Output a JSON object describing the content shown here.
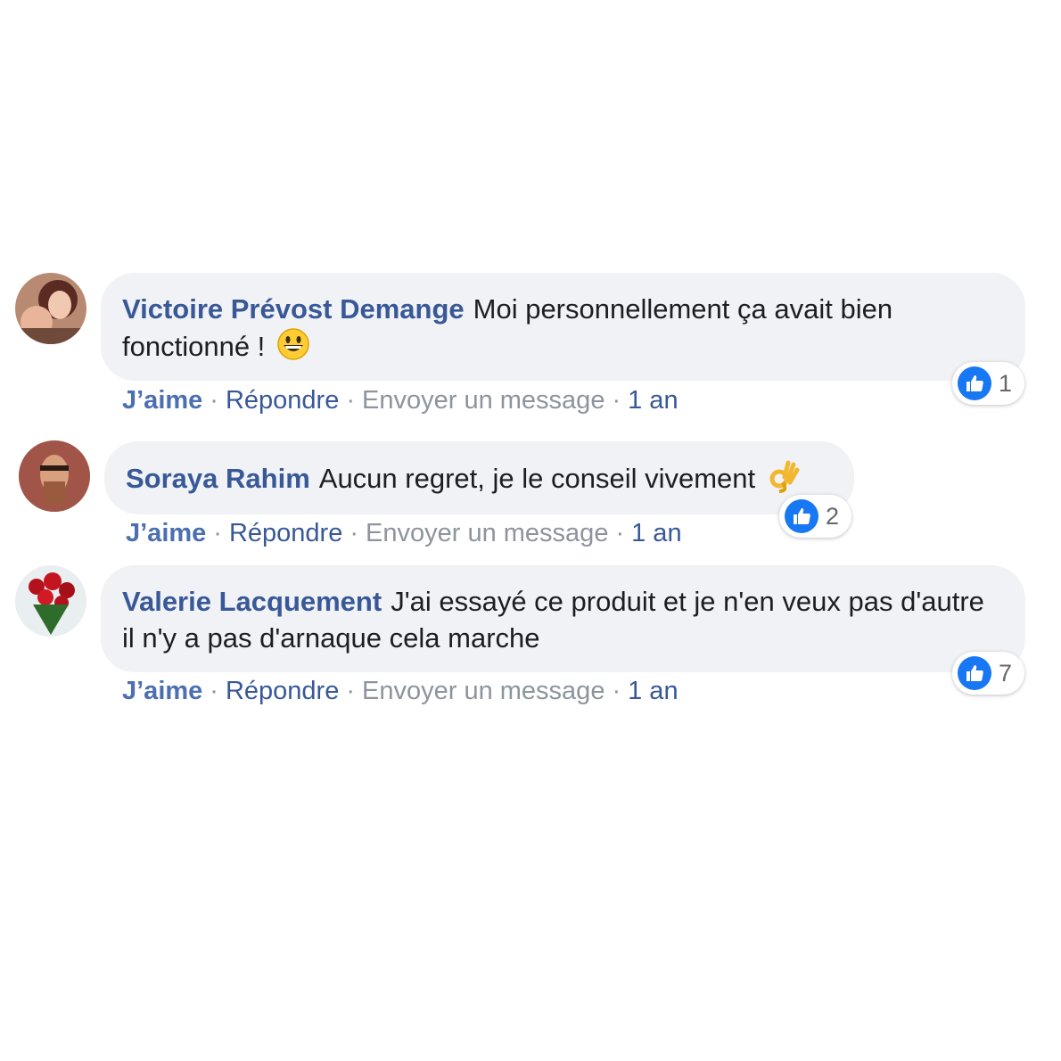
{
  "comments": [
    {
      "author": "Victoire Prévost Demange",
      "text": "Moi personnellement ça avait bien fonctionné !",
      "emoji_icon": "grinning-face-emoji",
      "reaction_count": "1",
      "like_label": "J’aime",
      "reply_label": "Répondre",
      "message_label": "Envoyer un message",
      "time": "1 an"
    },
    {
      "author": "Soraya Rahim",
      "text": "Aucun regret, je le conseil vivement",
      "emoji_icon": "ok-hand-emoji",
      "reaction_count": "2",
      "like_label": "J’aime",
      "reply_label": "Répondre",
      "message_label": "Envoyer un message",
      "time": "1 an"
    },
    {
      "author": "Valerie Lacquement",
      "text": "J'ai essayé ce produit et je n'en veux pas d'autre il n'y a pas d'arnaque cela marche",
      "emoji_icon": "",
      "reaction_count": "7",
      "like_label": "J’aime",
      "reply_label": "Répondre",
      "message_label": "Envoyer un message",
      "time": "1 an"
    }
  ],
  "separator": "·",
  "colors": {
    "bubble": "#f0f2f5",
    "author": "#385898",
    "like_blue": "#1877f2",
    "muted": "#8d949e"
  }
}
